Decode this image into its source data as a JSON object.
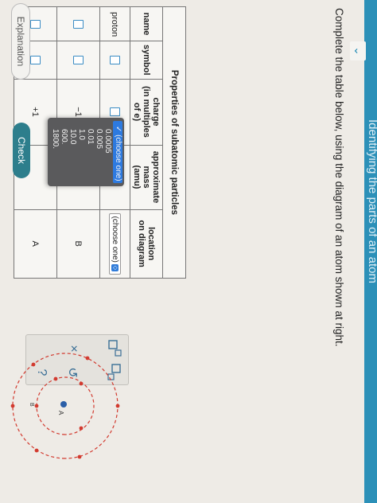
{
  "header": {
    "title": "Identifying the parts of an atom",
    "chevron": "⌄"
  },
  "instruction": "Complete the table below, using the diagram of an atom shown at right.",
  "table": {
    "title": "Properties of subatomic particles",
    "headers": {
      "name": "name",
      "symbol": "symbol",
      "charge_l1": "charge",
      "charge_l2": "(in multiples of e)",
      "mass_l1": "approximate",
      "mass_l2": "mass",
      "mass_l3": "(amu)",
      "location_l1": "location",
      "location_l2": "on diagram"
    },
    "rows": [
      {
        "name": "proton",
        "charge": "",
        "mass": "(choose one)",
        "location": "(choose one)"
      },
      {
        "name": "",
        "charge": "−1",
        "mass": "",
        "location": "B"
      },
      {
        "name": "",
        "charge": "+1",
        "mass": "",
        "location": "A"
      }
    ]
  },
  "dropdown": {
    "selected": "(choose one)",
    "options": [
      "0.0005",
      "0.005",
      "0.01",
      "1.0",
      "10.0",
      "600.",
      "1800."
    ]
  },
  "tools": {
    "close": "×",
    "undo": "↺",
    "help": "?"
  },
  "diagram": {
    "label_a": "A",
    "label_b": "B"
  },
  "buttons": {
    "explanation": "Explanation",
    "check": "Check"
  },
  "colors": {
    "topbar": "#2c90b8",
    "accent": "#3a8cc4",
    "check": "#2d7e8c",
    "electron": "#d23a2f"
  }
}
